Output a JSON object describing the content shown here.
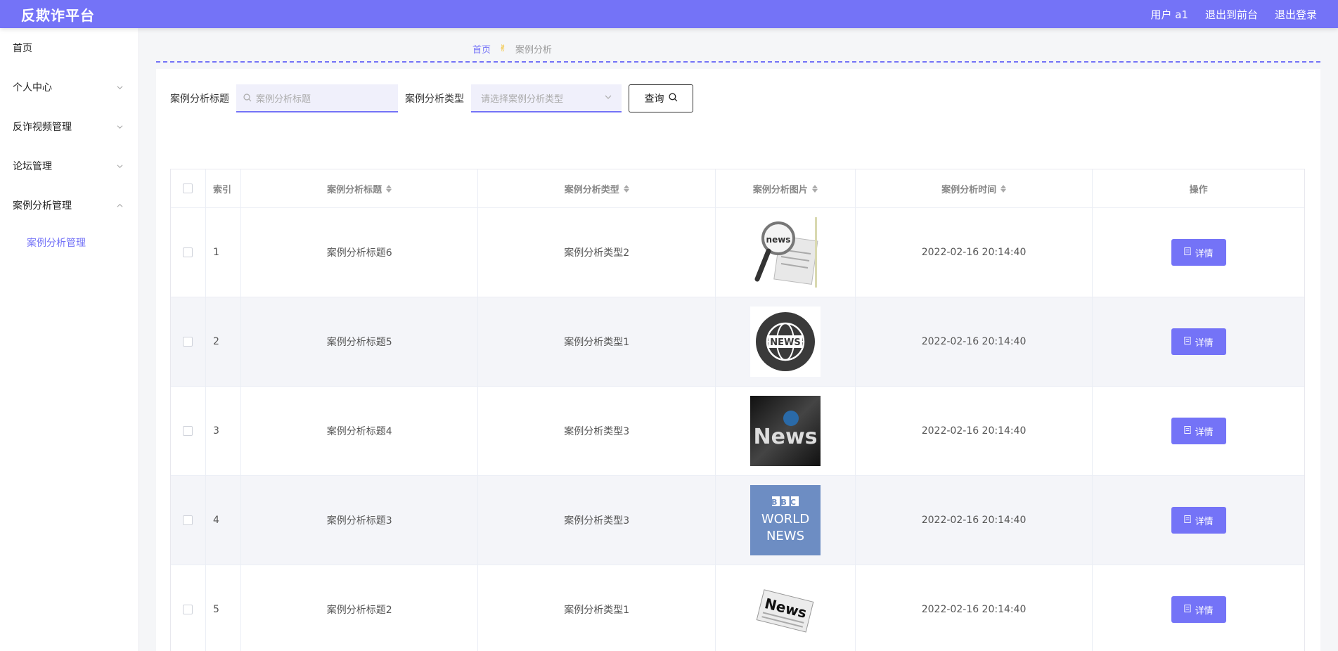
{
  "header": {
    "brand": "反欺诈平台",
    "user": "用户 a1",
    "to_front": "退出到前台",
    "logout": "退出登录"
  },
  "sidebar": {
    "items": [
      {
        "label": "首页",
        "chevron": ""
      },
      {
        "label": "个人中心",
        "chevron": "down"
      },
      {
        "label": "反诈视频管理",
        "chevron": "down"
      },
      {
        "label": "论坛管理",
        "chevron": "down"
      },
      {
        "label": "案例分析管理",
        "chevron": "up"
      }
    ],
    "sub_item": "案例分析管理"
  },
  "breadcrumb": {
    "home": "首页",
    "separator": "✌",
    "current": "案例分析"
  },
  "search": {
    "title_label": "案例分析标题",
    "title_placeholder": "案例分析标题",
    "type_label": "案例分析类型",
    "type_placeholder": "请选择案例分析类型",
    "query_label": "查询"
  },
  "table": {
    "headers": {
      "index": "索引",
      "title": "案例分析标题",
      "type": "案例分析类型",
      "image": "案例分析图片",
      "time": "案例分析时间",
      "ops": "操作"
    },
    "detail_label": "详情",
    "rows": [
      {
        "index": "1",
        "title": "案例分析标题6",
        "type": "案例分析类型2",
        "image": "magnifier-news-image",
        "time": "2022-02-16 20:14:40"
      },
      {
        "index": "2",
        "title": "案例分析标题5",
        "type": "案例分析类型1",
        "image": "globe-news-image",
        "time": "2022-02-16 20:14:40"
      },
      {
        "index": "3",
        "title": "案例分析标题4",
        "type": "案例分析类型3",
        "image": "dark-news-image",
        "time": "2022-02-16 20:14:40"
      },
      {
        "index": "4",
        "title": "案例分析标题3",
        "type": "案例分析类型3",
        "image": "bbc-world-news-image",
        "time": "2022-02-16 20:14:40"
      },
      {
        "index": "5",
        "title": "案例分析标题2",
        "type": "案例分析类型1",
        "image": "newspaper-news-image",
        "time": "2022-02-16 20:14:40"
      }
    ]
  },
  "image_text": {
    "magnifier": "news",
    "globe": "NEWS",
    "dark": "News",
    "bbc_1": "BBC",
    "bbc_2": "WORLD",
    "bbc_3": "NEWS",
    "paper": "News"
  },
  "colors": {
    "accent": "#7473f7",
    "breadcrumb_sep": "#f2b400"
  }
}
